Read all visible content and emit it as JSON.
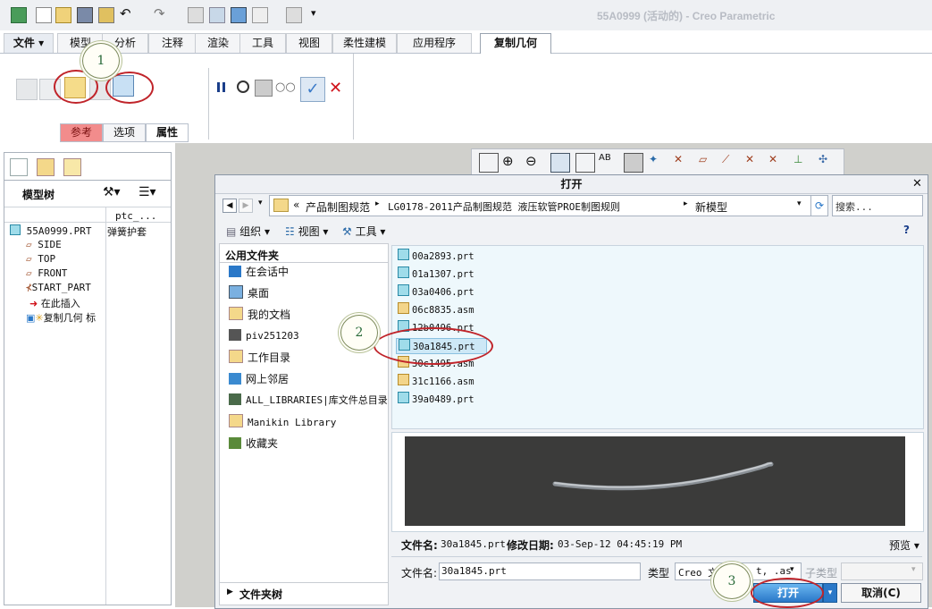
{
  "titlebar": {
    "title": "55A0999 (活动的) - Creo Parametric"
  },
  "menu_tabs": [
    "文件 ▾",
    "模型",
    "分析",
    "注释",
    "渲染",
    "工具",
    "视图",
    "柔性建模",
    "应用程序",
    "复制几何"
  ],
  "ribbon": {
    "subtabs": [
      "参考",
      "选项",
      "属性"
    ]
  },
  "model_tree": {
    "header": "模型树",
    "column": "ptc_...",
    "items": [
      {
        "label": "55A0999.PRT",
        "value": "弹簧护套"
      },
      {
        "label": "SIDE"
      },
      {
        "label": "TOP"
      },
      {
        "label": "FRONT"
      },
      {
        "label": "START_PART"
      },
      {
        "label": "在此插入"
      },
      {
        "label": "复制几何 标"
      }
    ]
  },
  "dialog": {
    "title": "打开",
    "path_prefix": "«",
    "path": [
      "产品制图规范",
      "LG0178-2011产品制图规范 液压软管PROE制图规则",
      "新模型"
    ],
    "search_placeholder": "搜索...",
    "toolbar": {
      "organize": "组织",
      "views": "视图",
      "tools": "工具"
    },
    "common_folders_header": "公用文件夹",
    "common_folders": [
      "在会话中",
      "桌面",
      "我的文档",
      "piv251203",
      "工作目录",
      "网上邻居",
      "ALL_LIBRARIES|库文件总目录",
      "Manikin Library",
      "收藏夹"
    ],
    "files": [
      {
        "name": "00a2893.prt",
        "type": "prt"
      },
      {
        "name": "01a1307.prt",
        "type": "prt"
      },
      {
        "name": "03a0406.prt",
        "type": "prt"
      },
      {
        "name": "06c8835.asm",
        "type": "asm"
      },
      {
        "name": "12b0496.prt",
        "type": "prt"
      },
      {
        "name": "30a1845.prt",
        "type": "prt",
        "selected": true
      },
      {
        "name": "30c1495.asm",
        "type": "asm"
      },
      {
        "name": "31c1166.asm",
        "type": "asm"
      },
      {
        "name": "39a0489.prt",
        "type": "prt"
      }
    ],
    "info": {
      "filename_label": "文件名:",
      "filename": "30a1845.prt",
      "date_label": "修改日期:",
      "date": "03-Sep-12 04:45:19 PM",
      "preview_label": "预览 ▾"
    },
    "bottom": {
      "filename_label": "文件名:",
      "filename_value": "30a1845.prt",
      "type_label": "类型",
      "type_value": "Creo 文",
      "type_value_end": "t, .as",
      "subtype_label": "子类型"
    },
    "folder_tree": "文件夹树",
    "open_button": "打开",
    "cancel_button": "取消(C)"
  },
  "callouts": [
    "1",
    "2",
    "3"
  ],
  "colors": {
    "accent": "#2a78c8",
    "highlight": "#f08080",
    "callout_ring": "#c0242a",
    "preview_bg": "#3b3b3a"
  }
}
